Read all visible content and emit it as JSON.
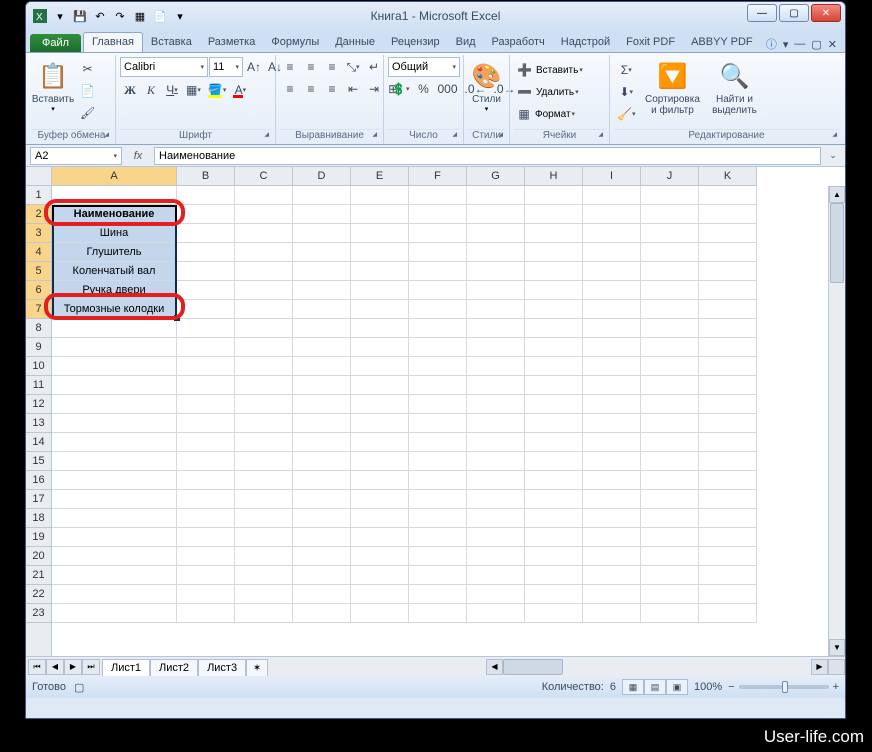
{
  "window": {
    "title": "Книга1 - Microsoft Excel"
  },
  "tabs": {
    "file": "Файл",
    "items": [
      "Главная",
      "Вставка",
      "Разметка",
      "Формулы",
      "Данные",
      "Рецензир",
      "Вид",
      "Разработч",
      "Надстрой",
      "Foxit PDF",
      "ABBYY PDF"
    ],
    "active": 0
  },
  "ribbon": {
    "clipboard": {
      "paste": "Вставить",
      "label": "Буфер обмена"
    },
    "font": {
      "name": "Calibri",
      "size": "11",
      "label": "Шрифт"
    },
    "alignment": {
      "label": "Выравнивание"
    },
    "number": {
      "format": "Общий",
      "label": "Число"
    },
    "styles": {
      "styles": "Стили",
      "label": "Стили"
    },
    "cells": {
      "insert": "Вставить",
      "delete": "Удалить",
      "format": "Формат",
      "label": "Ячейки"
    },
    "editing": {
      "sort": "Сортировка и фильтр",
      "find": "Найти и выделить",
      "label": "Редактирование"
    }
  },
  "formula_bar": {
    "name_box": "A2",
    "value": "Наименование"
  },
  "columns": [
    "A",
    "B",
    "C",
    "D",
    "E",
    "F",
    "G",
    "H",
    "I",
    "J",
    "K"
  ],
  "rows": 23,
  "selected_rows": [
    2,
    3,
    4,
    5,
    6,
    7
  ],
  "cellsA": {
    "2": "Наименование",
    "3": "Шина",
    "4": "Глушитель",
    "5": "Коленчатый вал",
    "6": "Ручка двери",
    "7": "Тормозные колодки"
  },
  "sheets": {
    "items": [
      "Лист1",
      "Лист2",
      "Лист3"
    ],
    "active": 0
  },
  "status": {
    "ready": "Готово",
    "count_label": "Количество:",
    "count": "6",
    "zoom": "100%"
  },
  "watermark": "User-life.com"
}
